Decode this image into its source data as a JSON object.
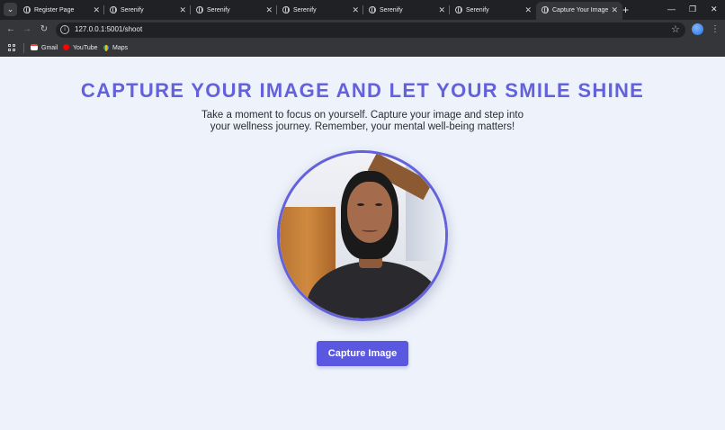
{
  "browser": {
    "tabs": [
      {
        "label": "Register Page",
        "active": false
      },
      {
        "label": "Serenify",
        "active": false
      },
      {
        "label": "Serenify",
        "active": false
      },
      {
        "label": "Serenify",
        "active": false
      },
      {
        "label": "Serenify",
        "active": false
      },
      {
        "label": "Serenify",
        "active": false
      },
      {
        "label": "Capture Your Image",
        "active": true
      }
    ],
    "url": "127.0.0.1:5001/shoot",
    "bookmarks": [
      {
        "label": "Gmail",
        "icon": "gmail-icon"
      },
      {
        "label": "YouTube",
        "icon": "youtube-icon"
      },
      {
        "label": "Maps",
        "icon": "maps-icon"
      }
    ]
  },
  "page": {
    "headline": "CAPTURE YOUR IMAGE AND LET YOUR SMILE SHINE",
    "subtext": "Take a moment to focus on yourself. Capture your image and step into your wellness journey. Remember, your mental well-being matters!",
    "capture_button": "Capture Image"
  },
  "colors": {
    "accent": "#6361dc",
    "button": "#5a57e0",
    "page_background": "#eef3fb",
    "chrome_dark": "#202124",
    "chrome_toolbar": "#35363a"
  }
}
